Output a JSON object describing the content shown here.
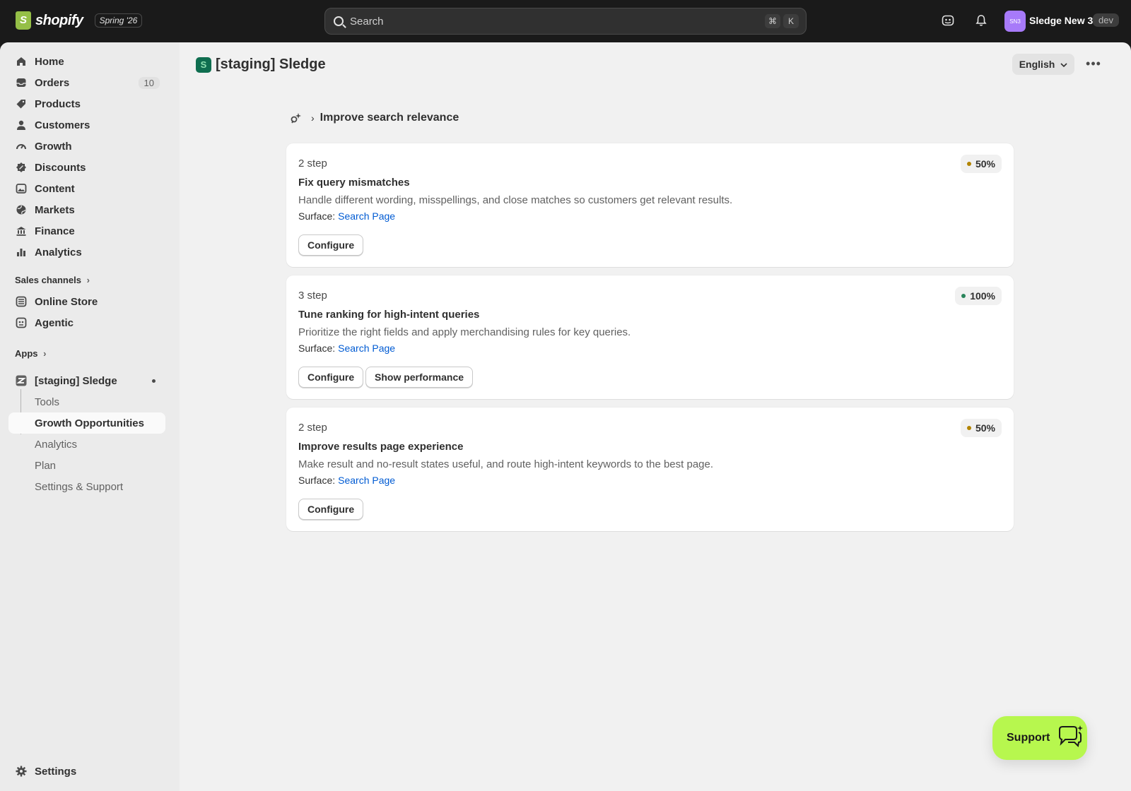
{
  "topbar": {
    "brand": "shopify",
    "edition": "Spring '26",
    "search_placeholder": "Search",
    "shortcut_cmd": "⌘",
    "shortcut_key": "K",
    "avatar_initials": "SN3",
    "store_name": "Sledge New 3",
    "env_badge": "dev"
  },
  "sidebar": {
    "items": [
      {
        "label": "Home",
        "icon": "home-icon"
      },
      {
        "label": "Orders",
        "icon": "inbox-icon",
        "count": "10"
      },
      {
        "label": "Products",
        "icon": "tag-icon"
      },
      {
        "label": "Customers",
        "icon": "person-icon"
      },
      {
        "label": "Growth",
        "icon": "gauge-icon"
      },
      {
        "label": "Discounts",
        "icon": "discount-icon"
      },
      {
        "label": "Content",
        "icon": "image-icon"
      },
      {
        "label": "Markets",
        "icon": "globe-icon"
      },
      {
        "label": "Finance",
        "icon": "bank-icon"
      },
      {
        "label": "Analytics",
        "icon": "bar-chart-icon"
      }
    ],
    "sales_channels_label": "Sales channels",
    "channels": [
      {
        "label": "Online Store",
        "icon": "store-icon"
      },
      {
        "label": "Agentic",
        "icon": "robot-icon"
      }
    ],
    "apps_label": "Apps",
    "app": {
      "label": "[staging] Sledge"
    },
    "app_subitems": [
      {
        "label": "Tools"
      },
      {
        "label": "Growth Opportunities",
        "active": true
      },
      {
        "label": "Analytics"
      },
      {
        "label": "Plan"
      },
      {
        "label": "Settings & Support"
      }
    ],
    "settings_label": "Settings"
  },
  "main": {
    "app_title": "[staging] Sledge",
    "language": "English",
    "breadcrumb_title": "Improve search relevance",
    "cards": [
      {
        "step": "2 step",
        "title": "Fix query mismatches",
        "description": "Handle different wording, misspellings, and close matches so customers get relevant results.",
        "surface_label": "Surface:",
        "surface_link": "Search Page",
        "progress": "50%",
        "progress_color": "#b28400",
        "buttons": [
          "Configure"
        ]
      },
      {
        "step": "3 step",
        "title": "Tune ranking for high-intent queries",
        "description": "Prioritize the right fields and apply merchandising rules for key queries.",
        "surface_label": "Surface:",
        "surface_link": "Search Page",
        "progress": "100%",
        "progress_color": "#29845a",
        "buttons": [
          "Configure",
          "Show performance"
        ]
      },
      {
        "step": "2 step",
        "title": "Improve results page experience",
        "description": "Make result and no-result states useful, and route high-intent keywords to the best page.",
        "surface_label": "Surface:",
        "surface_link": "Search Page",
        "progress": "50%",
        "progress_color": "#b28400",
        "buttons": [
          "Configure"
        ]
      }
    ],
    "support_label": "Support"
  },
  "colors": {
    "topbar_bg": "#1a1a1a",
    "support_bg": "#b7f74e",
    "link": "#005bd3"
  }
}
